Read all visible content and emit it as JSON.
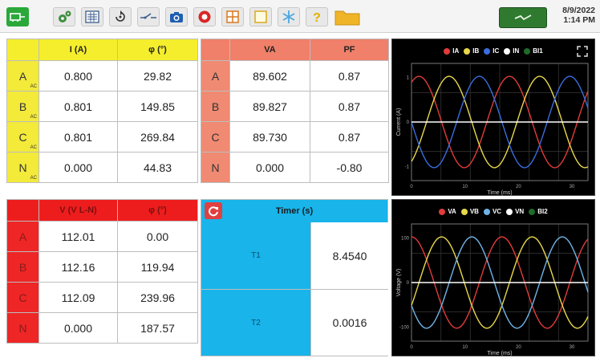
{
  "toolbar": {
    "icons": [
      "app-logo-icon",
      "settings-icon",
      "calculator-icon",
      "rotate-icon",
      "switch-icon",
      "camera-icon",
      "record-icon",
      "grid-icon",
      "window-icon",
      "snowflake-icon",
      "help-icon",
      "folder-icon"
    ],
    "date": "8/9/2022",
    "time": "1:14 PM"
  },
  "current_table": {
    "headers": [
      "I (A)",
      "φ (°)"
    ],
    "rows": [
      {
        "label": "A",
        "sub": "AC",
        "value": "0.800",
        "phase": "29.82"
      },
      {
        "label": "B",
        "sub": "AC",
        "value": "0.801",
        "phase": "149.85"
      },
      {
        "label": "C",
        "sub": "AC",
        "value": "0.801",
        "phase": "269.84"
      },
      {
        "label": "N",
        "sub": "AC",
        "value": "0.000",
        "phase": "44.83"
      }
    ]
  },
  "power_table": {
    "headers": [
      "VA",
      "PF"
    ],
    "rows": [
      {
        "label": "A",
        "va": "89.602",
        "pf": "0.87"
      },
      {
        "label": "B",
        "va": "89.827",
        "pf": "0.87"
      },
      {
        "label": "C",
        "va": "89.730",
        "pf": "0.87"
      },
      {
        "label": "N",
        "va": "0.000",
        "pf": "-0.80"
      }
    ]
  },
  "voltage_table": {
    "headers": [
      "V (V L-N)",
      "φ (°)"
    ],
    "rows": [
      {
        "label": "A",
        "value": "112.01",
        "phase": "0.00"
      },
      {
        "label": "B",
        "value": "112.16",
        "phase": "119.94"
      },
      {
        "label": "C",
        "value": "112.09",
        "phase": "239.96"
      },
      {
        "label": "N",
        "value": "0.000",
        "phase": "187.57"
      }
    ]
  },
  "timer": {
    "title": "Timer (s)",
    "rows": [
      {
        "label": "T1",
        "value": "8.4540"
      },
      {
        "label": "T2",
        "value": "0.0016"
      }
    ]
  },
  "current_scope": {
    "legend": [
      {
        "name": "IA",
        "color": "#e23b3b"
      },
      {
        "name": "IB",
        "color": "#e8d84a"
      },
      {
        "name": "IC",
        "color": "#3a6de0"
      },
      {
        "name": "IN",
        "color": "#ffffff"
      },
      {
        "name": "BI1",
        "color": "#1e6b2a"
      }
    ],
    "ylabel": "Current (A)",
    "xlabel": "Time (ms)",
    "yticks": [
      "1",
      "0",
      "-1"
    ],
    "xticks": [
      "0",
      "10",
      "20",
      "30"
    ]
  },
  "voltage_scope": {
    "legend": [
      {
        "name": "VA",
        "color": "#e23b3b"
      },
      {
        "name": "VB",
        "color": "#e8d84a"
      },
      {
        "name": "VC",
        "color": "#6fb4e8"
      },
      {
        "name": "VN",
        "color": "#ffffff"
      },
      {
        "name": "BI2",
        "color": "#1e6b2a"
      }
    ],
    "ylabel": "Voltage (V)",
    "xlabel": "Time (ms)",
    "yticks": [
      "100",
      "0",
      "-100"
    ],
    "xticks": [
      "0",
      "10",
      "20",
      "30"
    ]
  }
}
